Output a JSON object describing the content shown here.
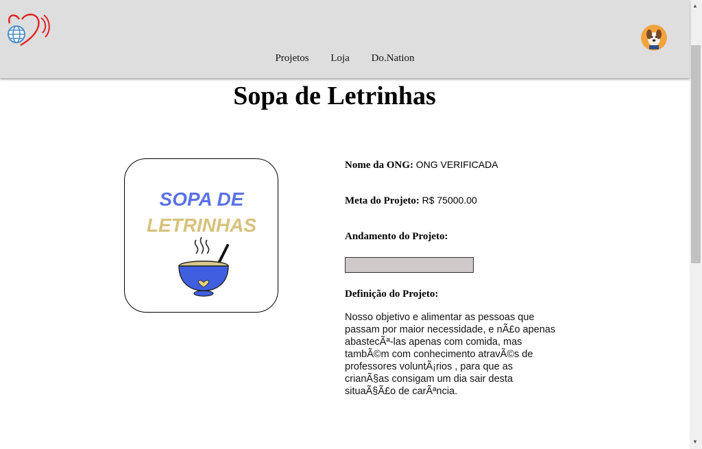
{
  "nav": {
    "items": [
      "Projetos",
      "Loja",
      "Do.Nation"
    ]
  },
  "page": {
    "title": "Sopa de Letrinhas"
  },
  "project_image": {
    "line1": "SOPA DE",
    "line2": "LETRINHAS"
  },
  "fields": {
    "ong_label": "Nome da ONG:",
    "ong_value": "ONG VERIFICADA",
    "goal_label": "Meta do Projeto:",
    "goal_value": "R$ 75000.00",
    "progress_label": "Andamento do Projeto:",
    "progress_fraction": 0,
    "definition_label": "Definição do Projeto:",
    "definition_text": "Nosso objetivo e alimentar as pessoas que passam por maior necessidade, e nÃ£o apenas abastecÃª-las apenas com comida, mas tambÃ©m com conhecimento atravÃ©s de professores voluntÃ¡rios , para que as crianÃ§as consigam um dia sair desta situaÃ§Ã£o de carÃªncia."
  },
  "colors": {
    "header_bg": "#dedede",
    "heart": "#e02020",
    "globe": "#4a8cc8",
    "soup_title": "#5b72e6",
    "soup_subtitle": "#d6c27a",
    "bowl": "#3f5fe0",
    "progress_track": "#cfc9c9",
    "avatar_bg": "#f2a33a"
  }
}
